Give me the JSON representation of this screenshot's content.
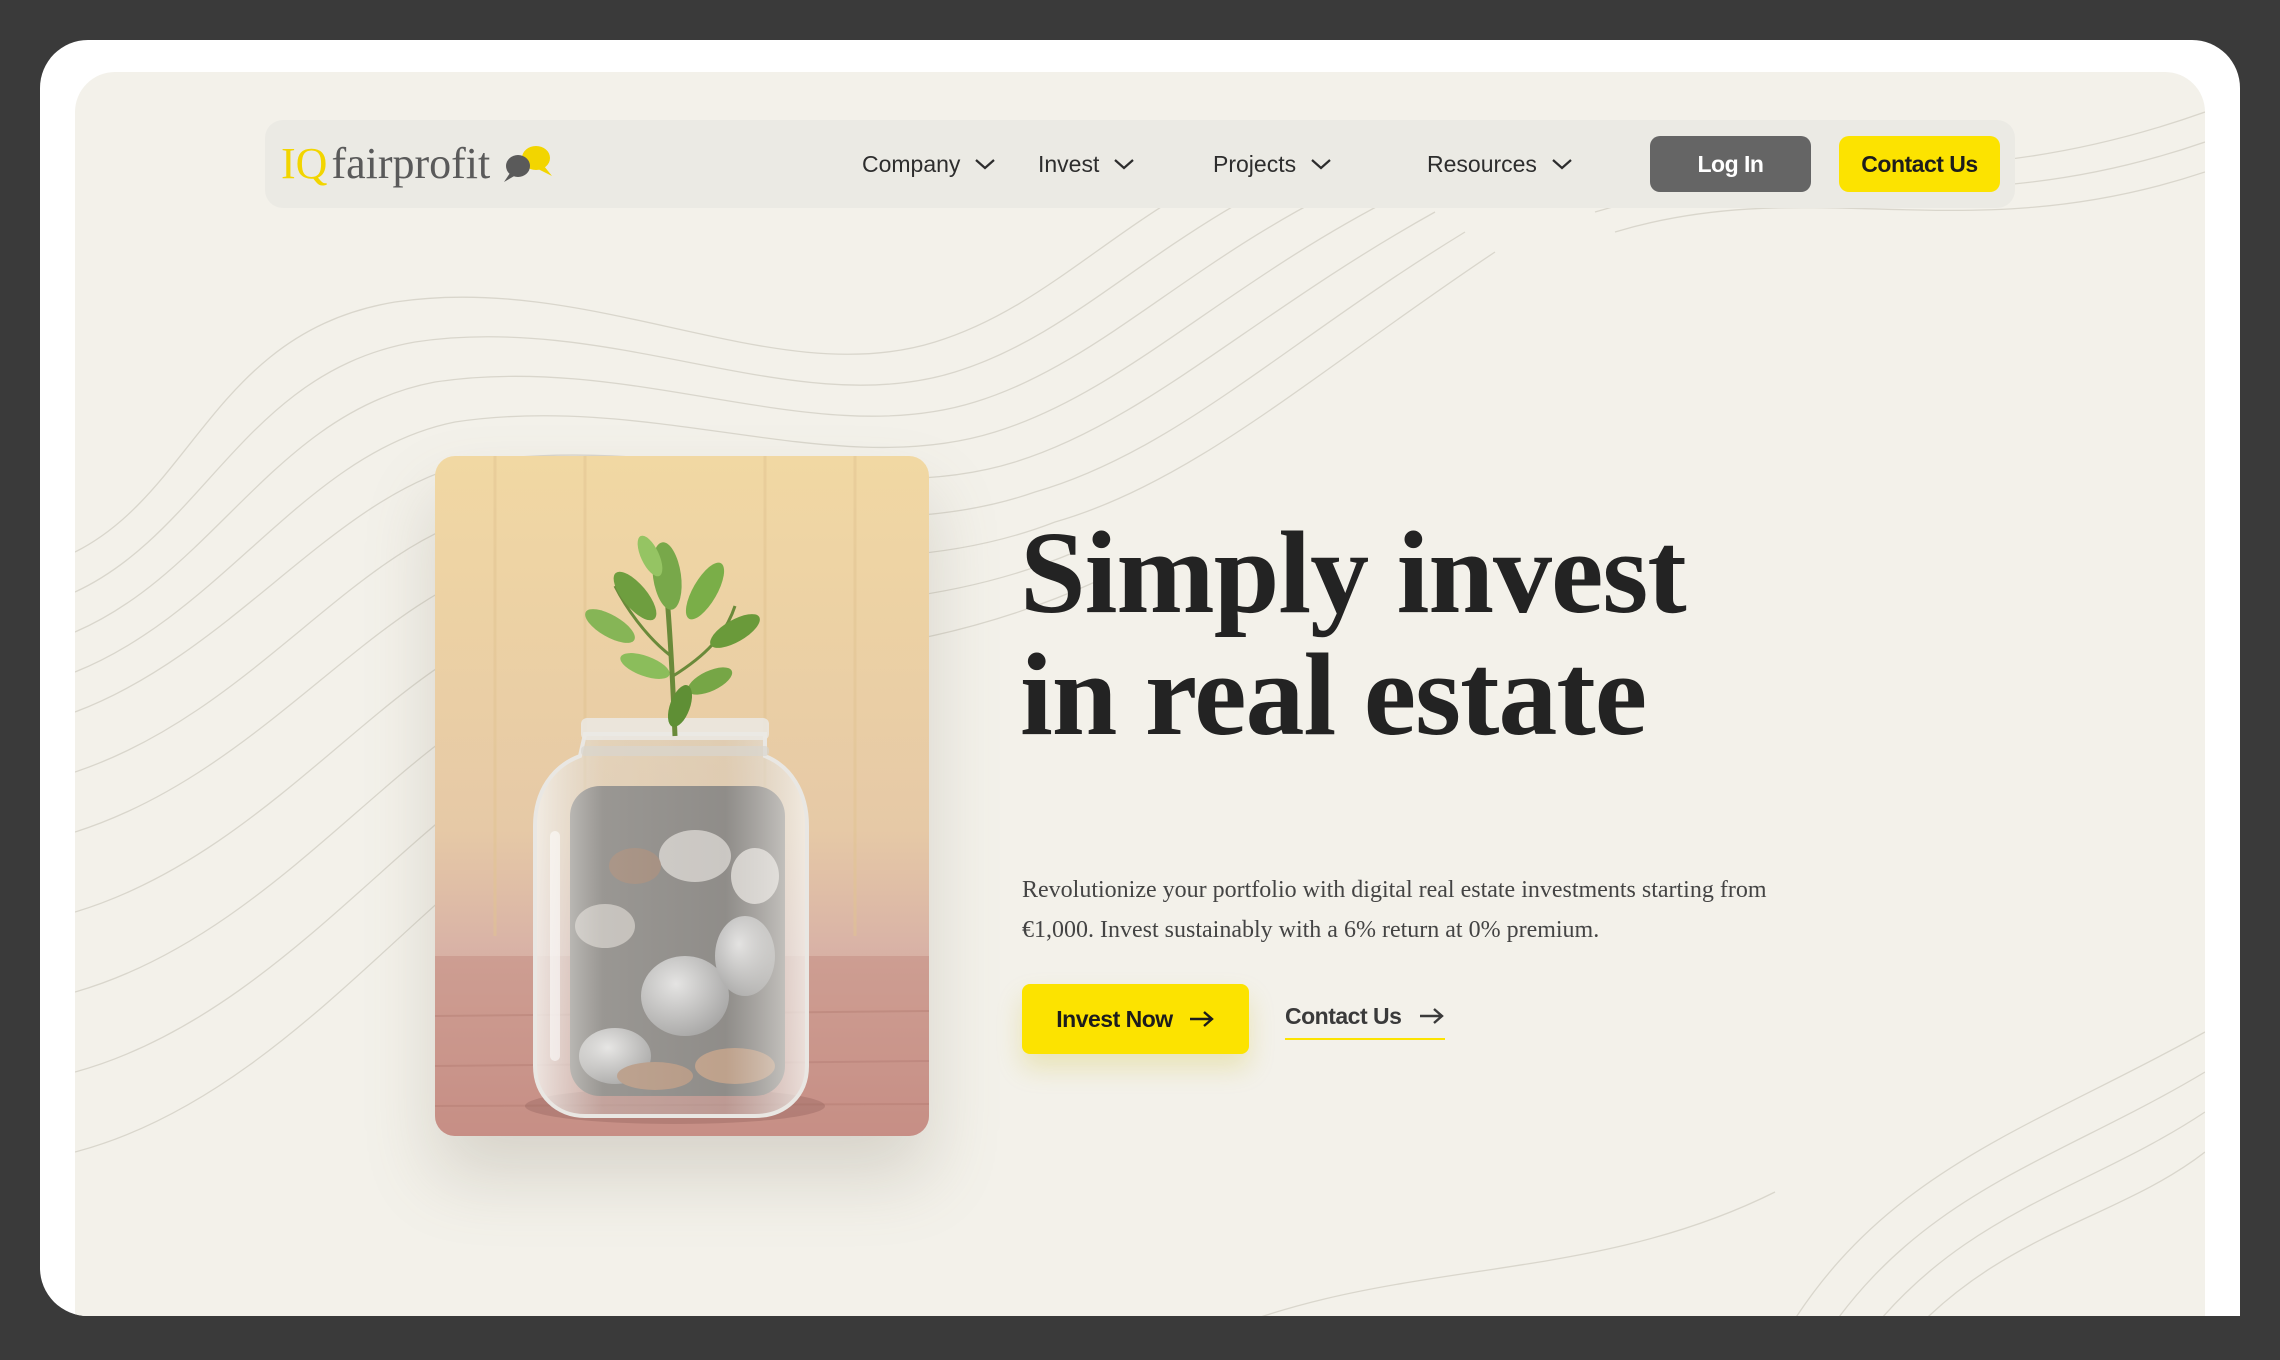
{
  "brand": {
    "logo_prefix": "IQ",
    "logo_name": "fairprofit",
    "accent_color": "#fce300",
    "dark_button_color": "#656565",
    "background_color": "#f3f1ea"
  },
  "nav": {
    "items": [
      {
        "label": "Company",
        "icon": "chevron-down-icon"
      },
      {
        "label": "Invest",
        "icon": "chevron-down-icon"
      },
      {
        "label": "Projects",
        "icon": "chevron-down-icon"
      },
      {
        "label": "Resources",
        "icon": "chevron-down-icon"
      }
    ],
    "login_label": "Log In",
    "contact_label": "Contact Us"
  },
  "hero": {
    "image_alt_subject": "glass jar of coins with a green plant",
    "headline_line1": "Simply invest",
    "headline_line2": "in real estate",
    "subtext": "Revolutionize your portfolio with digital real estate investments starting from €1,000. Invest sustainably with a 6% return at 0% premium.",
    "primary_cta": "Invest Now",
    "secondary_cta": "Contact Us",
    "cta_icon": "arrow-right-icon"
  }
}
